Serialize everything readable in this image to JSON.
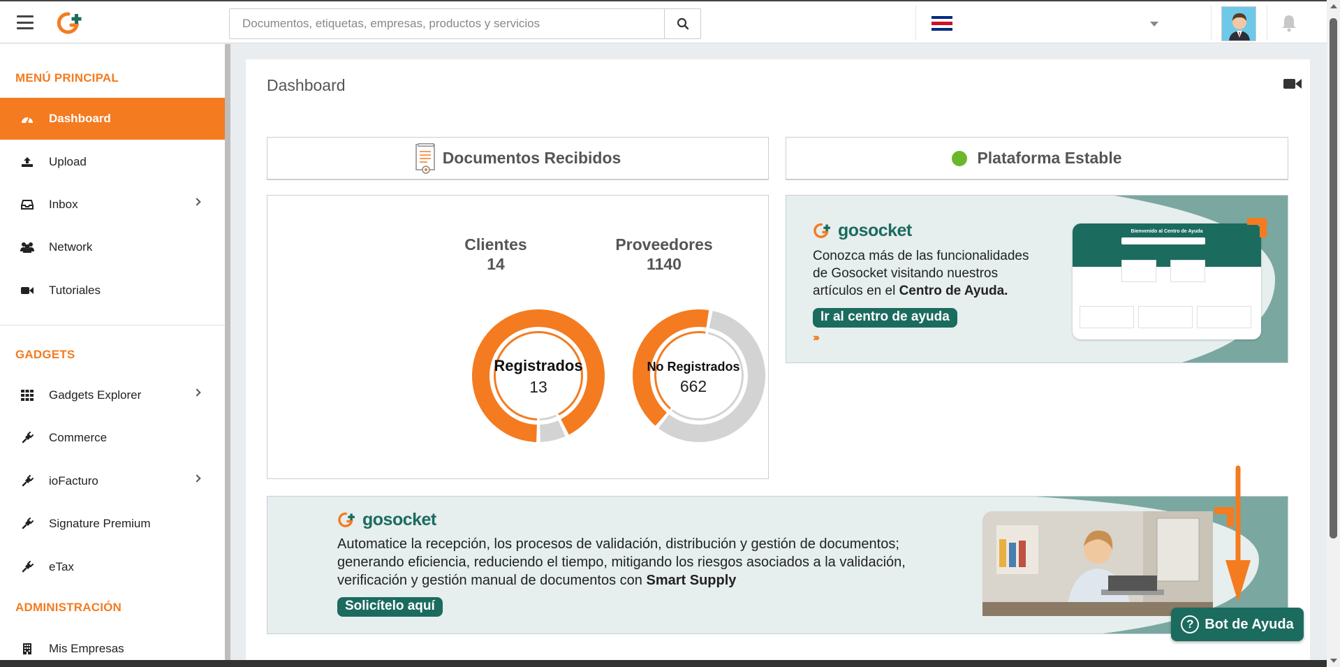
{
  "header": {
    "search_placeholder": "Documentos, etiquetas, empresas, productos y servicios"
  },
  "sidebar": {
    "main_menu_title": "MENÚ PRINCIPAL",
    "main_items": [
      {
        "label": "Dashboard",
        "icon": "dashboard-icon",
        "active": true
      },
      {
        "label": "Upload",
        "icon": "upload-icon"
      },
      {
        "label": "Inbox",
        "icon": "inbox-icon",
        "has_submenu": true
      },
      {
        "label": "Network",
        "icon": "users-icon"
      },
      {
        "label": "Tutoriales",
        "icon": "video-icon"
      }
    ],
    "gadgets_title": "GADGETS",
    "gadget_items": [
      {
        "label": "Gadgets Explorer",
        "icon": "grid-icon",
        "has_submenu": true
      },
      {
        "label": "Commerce",
        "icon": "plug-icon"
      },
      {
        "label": "ioFacturo",
        "icon": "plug-icon",
        "has_submenu": true
      },
      {
        "label": "Signature Premium",
        "icon": "plug-icon"
      },
      {
        "label": "eTax",
        "icon": "plug-icon"
      }
    ],
    "admin_title": "ADMINISTRACIÓN",
    "admin_items": [
      {
        "label": "Mis Empresas",
        "icon": "building-icon"
      }
    ]
  },
  "main": {
    "page_title": "Dashboard",
    "docs_panel_title": "Documentos Recibidos",
    "status_panel_title": "Plataforma Estable",
    "clients_label": "Clientes",
    "clients_count": "14",
    "suppliers_label": "Proveedores",
    "suppliers_count": "1140",
    "registered_label": "Registrados",
    "registered_value": "13",
    "unregistered_label": "No Registrados",
    "unregistered_value": "662"
  },
  "chart_data": [
    {
      "type": "pie",
      "title": "Clientes",
      "total": 14,
      "slices": [
        {
          "label": "Registrados",
          "value": 13,
          "color": "#f47b20"
        },
        {
          "label": "No Registrados",
          "value": 1,
          "color": "#d3d3d3"
        }
      ]
    },
    {
      "type": "pie",
      "title": "Proveedores",
      "total": 1140,
      "slices": [
        {
          "label": "No Registrados",
          "value": 662,
          "color": "#d3d3d3"
        },
        {
          "label": "Registrados",
          "value": 478,
          "color": "#f47b20"
        }
      ]
    }
  ],
  "help_banner": {
    "brand": "gosocket",
    "text_line1": "Conozca más de las funcionalidades",
    "text_line2": "de Gosocket visitando nuestros",
    "text_line3_plain": "artículos en el ",
    "text_line3_bold": "Centro de Ayuda.",
    "button_label": "Ir al centro de ayuda",
    "chevrons": "›››",
    "preview_title": "Bienvenido al Centro de Ayuda"
  },
  "supply_banner": {
    "brand": "gosocket",
    "text_line1": "Automatice la recepción, los procesos de validación, distribución y gestión de documentos;",
    "text_line2": "generando eficiencia, reduciendo el tiempo, mitigando los riesgos asociados a la validación,",
    "text_line3_plain": "verificación y gestión manual de documentos con ",
    "text_line3_bold": "Smart Supply",
    "button_label": "Solicítelo aquí"
  },
  "bot": {
    "label": "Bot de Ayuda"
  },
  "colors": {
    "accent": "#f47b20",
    "brand_green": "#1b6b5f",
    "status_green": "#6ab82a",
    "chart_gray": "#d3d3d3"
  }
}
